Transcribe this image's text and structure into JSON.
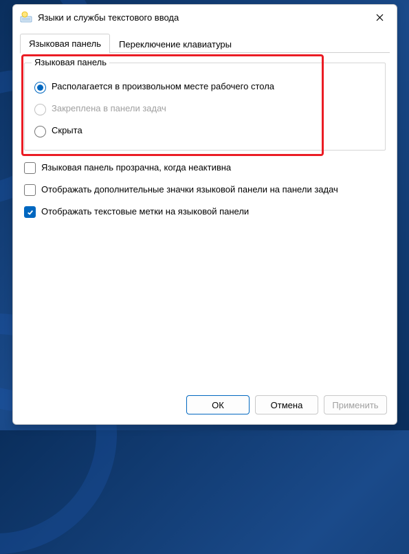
{
  "window": {
    "title": "Языки и службы текстового ввода"
  },
  "tabs": [
    {
      "label": "Языковая панель",
      "active": true
    },
    {
      "label": "Переключение клавиатуры",
      "active": false
    }
  ],
  "group": {
    "legend": "Языковая панель",
    "options": [
      {
        "label": "Располагается в произвольном месте рабочего стола",
        "checked": true,
        "disabled": false
      },
      {
        "label": "Закреплена в панели задач",
        "checked": false,
        "disabled": true
      },
      {
        "label": "Скрыта",
        "checked": false,
        "disabled": false
      }
    ]
  },
  "checks": [
    {
      "label": "Языковая панель прозрачна, когда неактивна",
      "checked": false
    },
    {
      "label": "Отображать дополнительные значки языковой панели на панели задач",
      "checked": false
    },
    {
      "label": "Отображать текстовые метки на языковой панели",
      "checked": true
    }
  ],
  "buttons": {
    "ok": "ОК",
    "cancel": "Отмена",
    "apply": "Применить"
  },
  "colors": {
    "accent": "#0067c0",
    "highlight": "#eb1c24"
  }
}
